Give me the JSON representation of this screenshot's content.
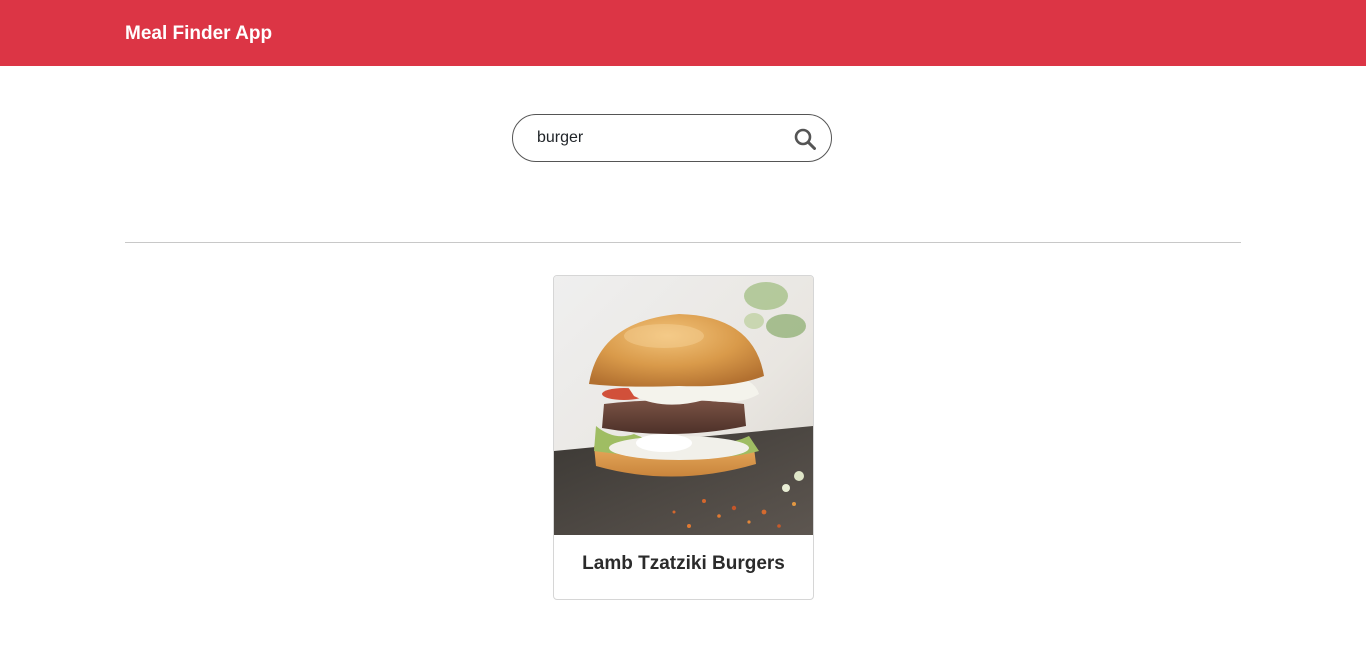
{
  "navbar": {
    "brand": "Meal Finder App",
    "background_color": "#dc3545"
  },
  "search": {
    "value": "burger",
    "placeholder": "",
    "button_icon": "search-icon"
  },
  "results": [
    {
      "title": "Lamb Tzatziki Burgers",
      "image_alt": "Lamb Tzatziki Burgers"
    }
  ]
}
